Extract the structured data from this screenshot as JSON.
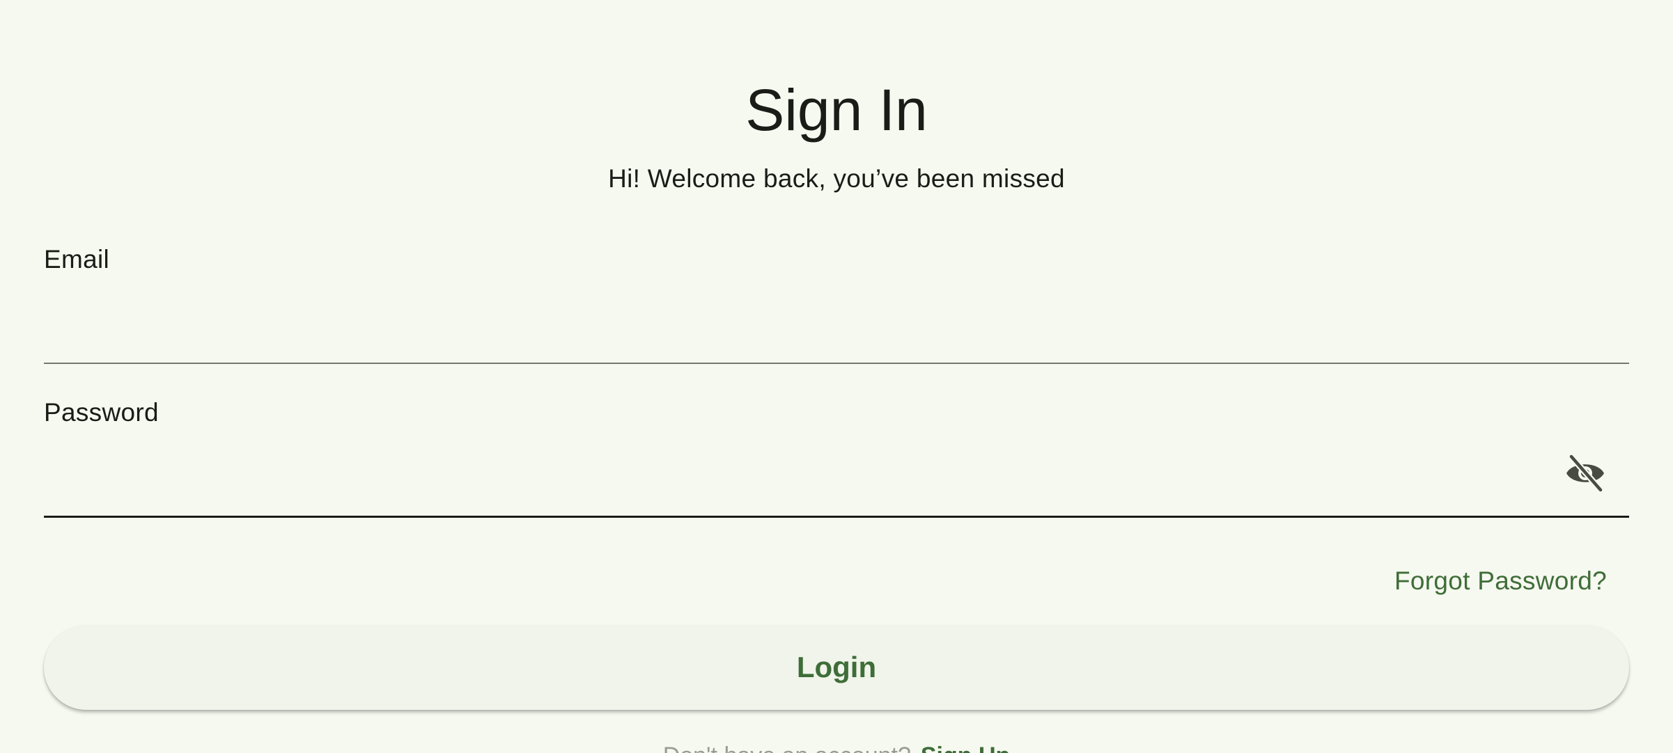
{
  "header": {
    "title": "Sign In",
    "subtitle": "Hi! Welcome back, you’ve been missed"
  },
  "form": {
    "email": {
      "label": "Email",
      "value": "",
      "placeholder": ""
    },
    "password": {
      "label": "Password",
      "value": "",
      "placeholder": "",
      "visibility_icon": "visibility-off-icon"
    },
    "forgot_password_label": "Forgot Password?",
    "login_label": "Login"
  },
  "footer": {
    "prompt": "Don't have an account?",
    "signup_label": "Sign Up"
  },
  "colors": {
    "background": "#f6f9f0",
    "accent": "#3f6d39",
    "text": "#1b1c18",
    "button_bg": "#f0f4ea"
  }
}
